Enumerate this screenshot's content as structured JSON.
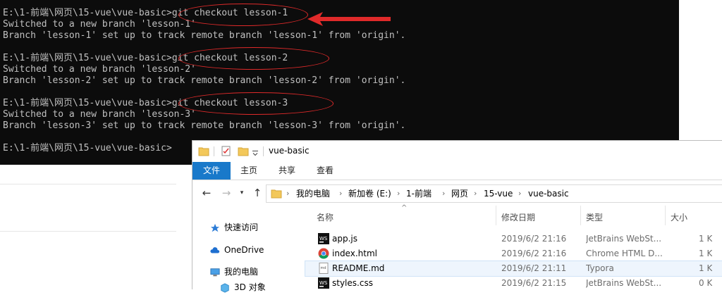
{
  "terminal": {
    "lines": [
      "E:\\1-前端\\网页\\15-vue\\vue-basic>git checkout lesson-1",
      "Switched to a new branch 'lesson-1'",
      "Branch 'lesson-1' set up to track remote branch 'lesson-1' from 'origin'.",
      "",
      "E:\\1-前端\\网页\\15-vue\\vue-basic>git checkout lesson-2",
      "Switched to a new branch 'lesson-2'",
      "Branch 'lesson-2' set up to track remote branch 'lesson-2' from 'origin'.",
      "",
      "E:\\1-前端\\网页\\15-vue\\vue-basic>git checkout lesson-3",
      "Switched to a new branch 'lesson-3'",
      "Branch 'lesson-3' set up to track remote branch 'lesson-3' from 'origin'.",
      "",
      "E:\\1-前端\\网页\\15-vue\\vue-basic>"
    ],
    "annotation_color": "#e02a2a"
  },
  "explorer": {
    "title": "vue-basic",
    "tabs": [
      "文件",
      "主页",
      "共享",
      "查看"
    ],
    "breadcrumb": [
      "我的电脑",
      "新加卷 (E:)",
      "1-前端",
      "网页",
      "15-vue",
      "vue-basic"
    ],
    "nav": [
      {
        "label": "快速访问",
        "icon": "star-icon"
      },
      {
        "label": "OneDrive",
        "icon": "cloud-icon"
      },
      {
        "label": "我的电脑",
        "icon": "computer-icon"
      },
      {
        "label": "3D 对象",
        "icon": "cube-icon"
      }
    ],
    "columns": {
      "name": "名称",
      "date": "修改日期",
      "type": "类型",
      "size": "大小"
    },
    "files": [
      {
        "name": "app.js",
        "date": "2019/6/2 21:16",
        "type": "JetBrains WebSt...",
        "size": "1 K",
        "icon": "webstorm-icon"
      },
      {
        "name": "index.html",
        "date": "2019/6/2 21:16",
        "type": "Chrome HTML D...",
        "size": "1 K",
        "icon": "chrome-icon"
      },
      {
        "name": "README.md",
        "date": "2019/6/2 21:11",
        "type": "Typora",
        "size": "1 K",
        "icon": "markdown-icon"
      },
      {
        "name": "styles.css",
        "date": "2019/6/2 21:15",
        "type": "JetBrains WebSt...",
        "size": "0 K",
        "icon": "webstorm-icon"
      }
    ],
    "accent_color": "#1979ca"
  }
}
